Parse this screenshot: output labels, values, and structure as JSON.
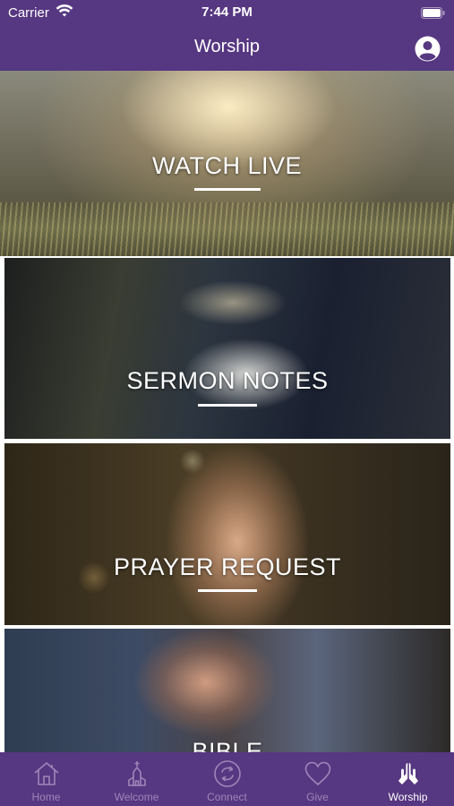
{
  "status_bar": {
    "carrier": "Carrier",
    "time": "7:44 PM"
  },
  "header": {
    "title": "Worship",
    "profile_icon": "profile-icon"
  },
  "tiles": [
    {
      "label": "WATCH LIVE"
    },
    {
      "label": "SERMON NOTES"
    },
    {
      "label": "PRAYER REQUEST"
    },
    {
      "label": "BIBLE"
    }
  ],
  "tab_bar": {
    "items": [
      {
        "label": "Home",
        "icon": "home-icon",
        "active": false
      },
      {
        "label": "Welcome",
        "icon": "church-icon",
        "active": false
      },
      {
        "label": "Connect",
        "icon": "connect-icon",
        "active": false
      },
      {
        "label": "Give",
        "icon": "heart-icon",
        "active": false
      },
      {
        "label": "Worship",
        "icon": "praying-hands-icon",
        "active": true
      }
    ]
  },
  "colors": {
    "brand_purple": "#563781",
    "tab_inactive": "#9d86b8",
    "tab_active": "#ffffff"
  }
}
